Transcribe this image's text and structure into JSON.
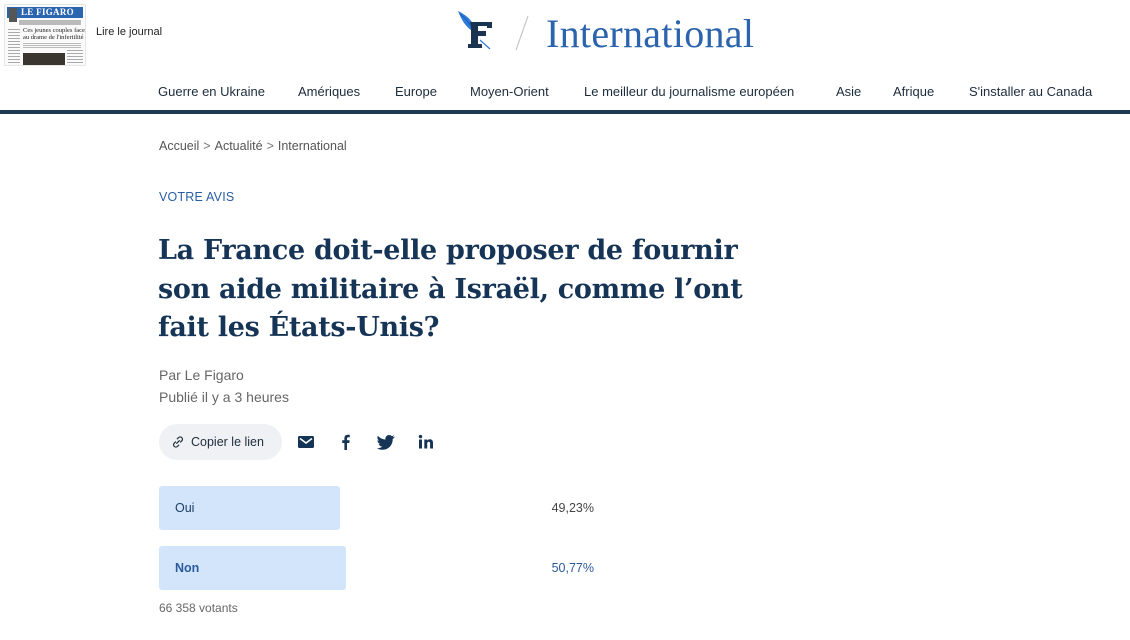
{
  "header": {
    "newspaper_thumbnail": {
      "masthead": "LE FIGARO",
      "headline": "Ces jeunes couples face au drame de l'infertilité"
    },
    "read_paper_label": "Lire le journal",
    "logo_icon": "le-figaro-f-logo",
    "section_title": "International",
    "accent_color": "#2b63ac",
    "nav_rule_color": "#1e3a52"
  },
  "nav": {
    "items": [
      {
        "label": "Guerre en Ukraine"
      },
      {
        "label": "Amériques"
      },
      {
        "label": "Europe"
      },
      {
        "label": "Moyen-Orient"
      },
      {
        "label": "Le meilleur du journalisme européen"
      },
      {
        "label": "Asie"
      },
      {
        "label": "Afrique"
      },
      {
        "label": "S'installer au Canada"
      }
    ]
  },
  "breadcrumb": {
    "items": [
      {
        "label": "Accueil"
      },
      {
        "label": "Actualité"
      },
      {
        "label": "International"
      }
    ],
    "separator": ">"
  },
  "article": {
    "kicker": "VOTRE AVIS",
    "title": "La France doit-elle proposer de fournir son aide militaire à Israël, comme l’ont fait les États-Unis?",
    "byline": "Par Le Figaro",
    "published": "Publié il y a 3 heures"
  },
  "share": {
    "copy_link_label": "Copier le lien",
    "icons": [
      "email-icon",
      "facebook-icon",
      "twitter-icon",
      "linkedin-icon"
    ]
  },
  "poll": {
    "options": [
      {
        "label": "Oui",
        "percent_label": "49,23%",
        "percent": 49.23,
        "winner": false
      },
      {
        "label": "Non",
        "percent_label": "50,77%",
        "percent": 50.77,
        "winner": true
      }
    ],
    "voters": "66 358 votants",
    "bar_color": "#d2e5fb"
  }
}
